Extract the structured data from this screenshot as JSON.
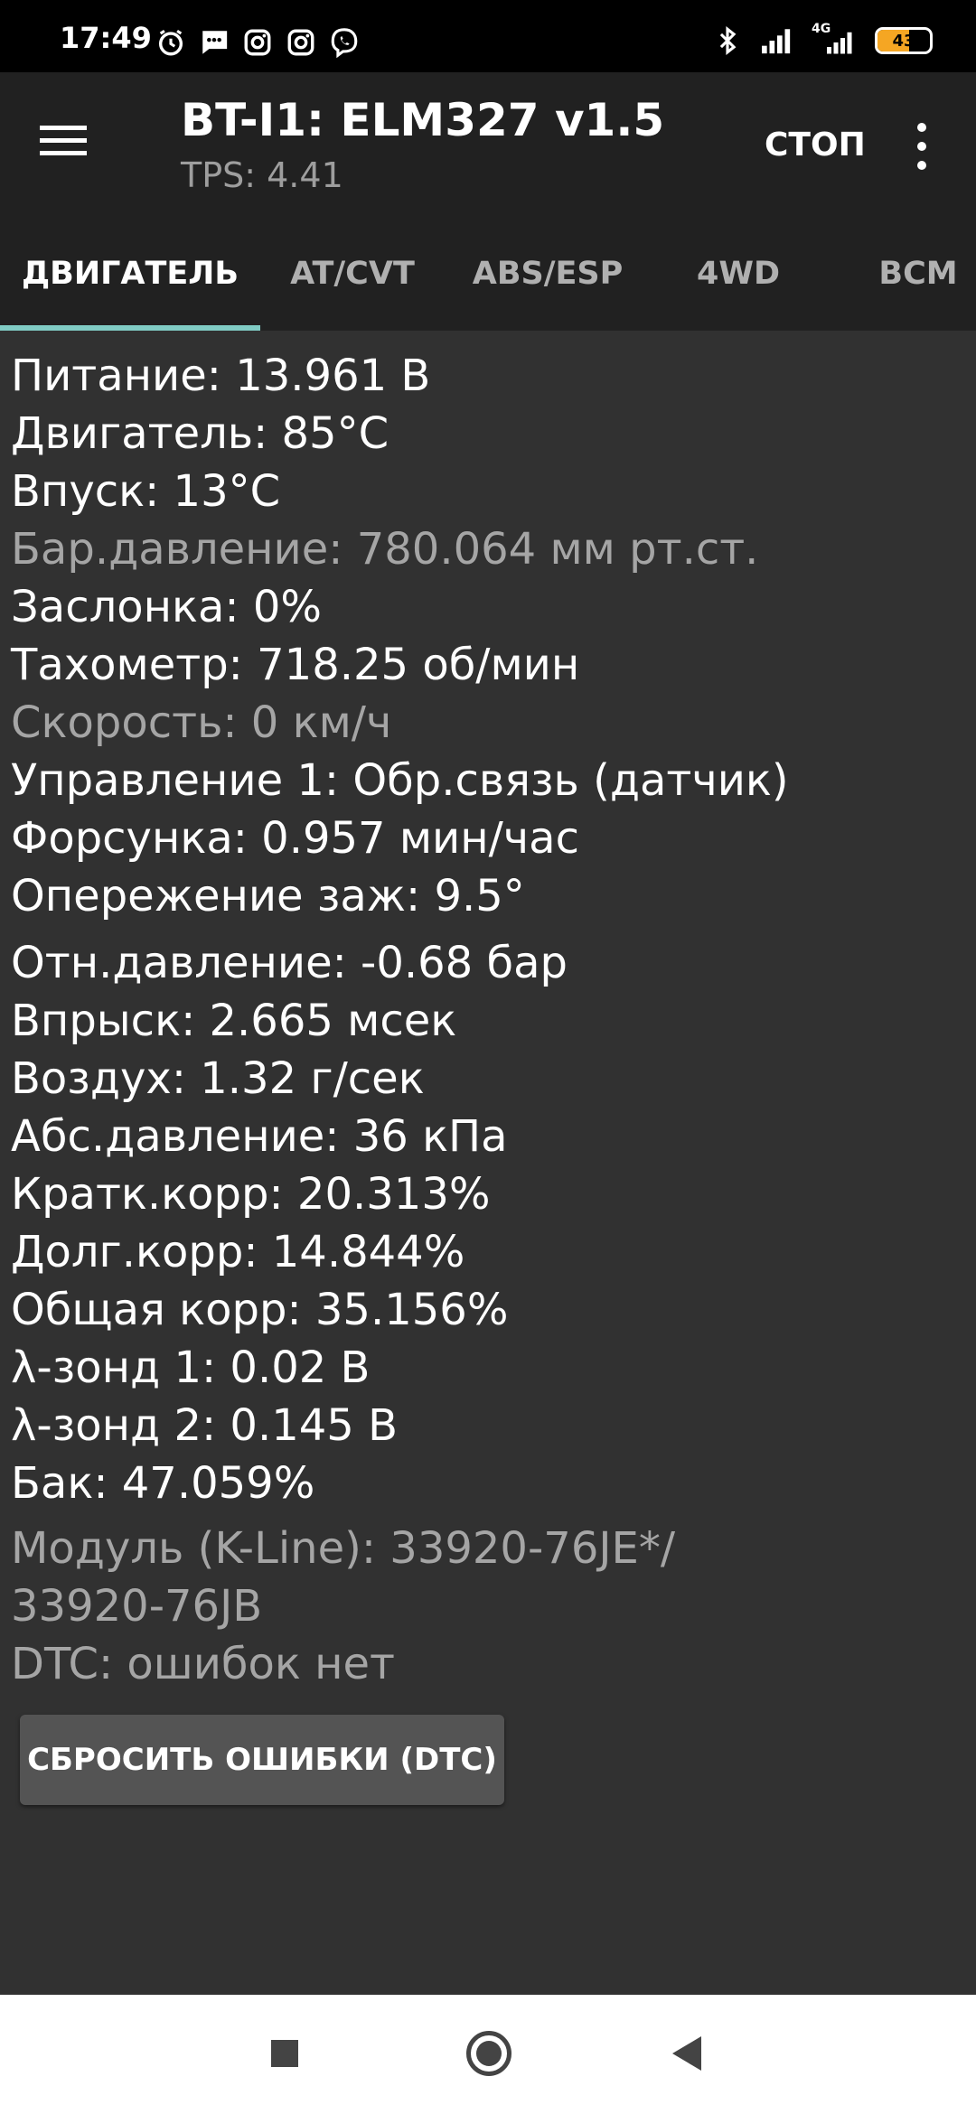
{
  "status_bar": {
    "time": "17:49",
    "battery": "43",
    "network": "4G",
    "icons": [
      "alarm-icon",
      "message-icon",
      "instagram-icon",
      "instagram-icon",
      "viber-icon",
      "bluetooth-icon",
      "signal-icon",
      "signal-4g-icon",
      "battery-icon"
    ],
    "battery_color": "#f5a623"
  },
  "app_bar": {
    "title": "BT-I1: ELM327 v1.5",
    "subtitle": "TPS: 4.41",
    "stop_label": "СТОП"
  },
  "tabs": [
    {
      "label": "ДВИГАТЕЛЬ",
      "active": true
    },
    {
      "label": "AT/CVT",
      "active": false
    },
    {
      "label": "ABS/ESP",
      "active": false
    },
    {
      "label": "4WD",
      "active": false
    },
    {
      "label": "BCM",
      "active": false
    }
  ],
  "colors": {
    "accent": "#80cbc4",
    "background": "#313131",
    "toolbar": "#212121"
  },
  "readings": [
    "Питание: 13.961 В",
    "Двигатель: 85°C",
    "Впуск: 13°C",
    "Бар.давление: 780.064 мм рт.ст.",
    "Заслонка: 0%",
    "Тахометр: 718.25 об/мин",
    "Скорость: 0 км/ч",
    "Управление 1: Обр.связь (датчик)",
    "Форсунка: 0.957 мин/час",
    "Опережение заж: 9.5°",
    "Отн.давление: -0.68 бар",
    "Впрыск: 2.665 мсек",
    "Воздух: 1.32 г/сек",
    "Абс.давление: 36 кПа",
    "Кратк.корр: 20.313%",
    "Долг.корр: 14.844%",
    "Общая корр: 35.156%",
    "λ-зонд 1: 0.02 В",
    "λ-зонд 2: 0.145 В",
    "Бак: 47.059%"
  ],
  "module": {
    "line1": "Модуль (K-Line): 33920-76JE*/",
    "line2": "33920-76JB",
    "dtc": "DTC: ошибок нет"
  },
  "reset_button_label": "СБРОСИТЬ ОШИБКИ (DTC)"
}
